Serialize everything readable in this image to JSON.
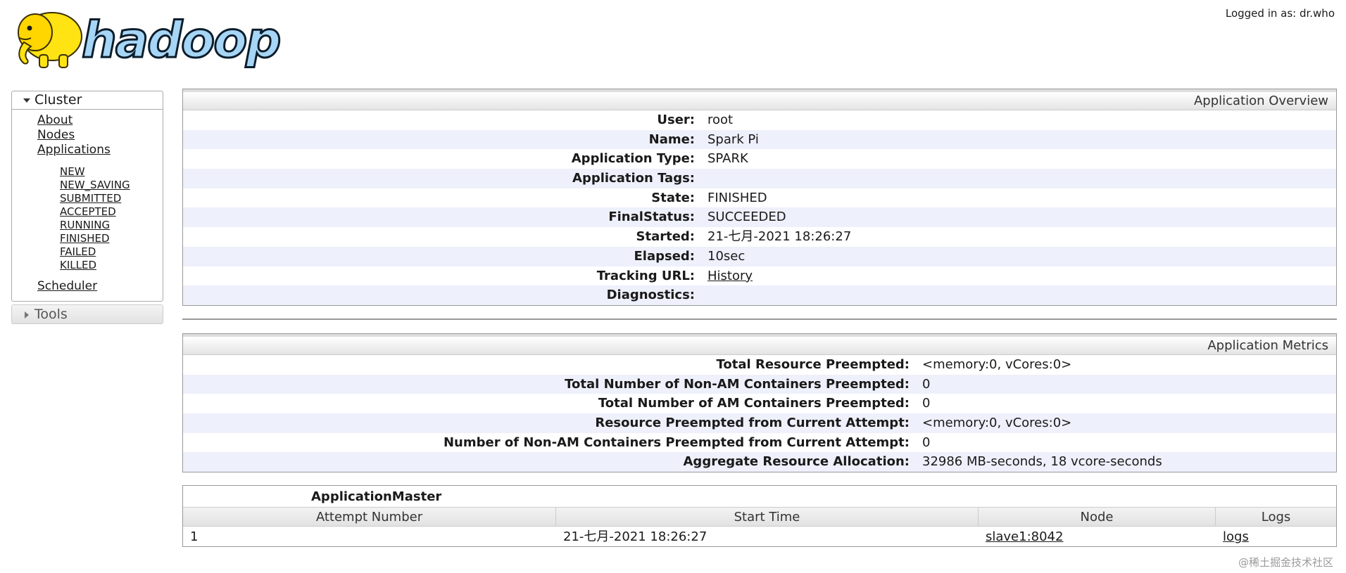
{
  "header": {
    "logo_text": "hadoop",
    "logged_in": "Logged in as: dr.who"
  },
  "sidebar": {
    "cluster": {
      "label": "Cluster",
      "links": [
        "About",
        "Nodes",
        "Applications"
      ],
      "app_states": [
        "NEW",
        "NEW_SAVING",
        "SUBMITTED",
        "ACCEPTED",
        "RUNNING",
        "FINISHED",
        "FAILED",
        "KILLED"
      ],
      "scheduler": "Scheduler"
    },
    "tools": {
      "label": "Tools"
    }
  },
  "overview": {
    "title": "Application Overview",
    "rows": [
      {
        "key": "User:",
        "value": "root"
      },
      {
        "key": "Name:",
        "value": "Spark Pi"
      },
      {
        "key": "Application Type:",
        "value": "SPARK"
      },
      {
        "key": "Application Tags:",
        "value": ""
      },
      {
        "key": "State:",
        "value": "FINISHED"
      },
      {
        "key": "FinalStatus:",
        "value": "SUCCEEDED"
      },
      {
        "key": "Started:",
        "value": "21-七月-2021 18:26:27"
      },
      {
        "key": "Elapsed:",
        "value": "10sec"
      },
      {
        "key": "Tracking URL:",
        "value": "History"
      },
      {
        "key": "Diagnostics:",
        "value": ""
      }
    ]
  },
  "metrics": {
    "title": "Application Metrics",
    "rows": [
      {
        "key": "Total Resource Preempted:",
        "value": "<memory:0, vCores:0>"
      },
      {
        "key": "Total Number of Non-AM Containers Preempted:",
        "value": "0"
      },
      {
        "key": "Total Number of AM Containers Preempted:",
        "value": "0"
      },
      {
        "key": "Resource Preempted from Current Attempt:",
        "value": "<memory:0, vCores:0>"
      },
      {
        "key": "Number of Non-AM Containers Preempted from Current Attempt:",
        "value": "0"
      },
      {
        "key": "Aggregate Resource Allocation:",
        "value": "32986 MB-seconds, 18 vcore-seconds"
      }
    ]
  },
  "attempts": {
    "caption": "ApplicationMaster",
    "columns": [
      "Attempt Number",
      "Start Time",
      "Node",
      "Logs"
    ],
    "rows": [
      {
        "attempt": "1",
        "start": "21-七月-2021 18:26:27",
        "node": "slave1:8042",
        "logs": "logs"
      }
    ]
  },
  "watermark": "@稀土掘金技术社区"
}
